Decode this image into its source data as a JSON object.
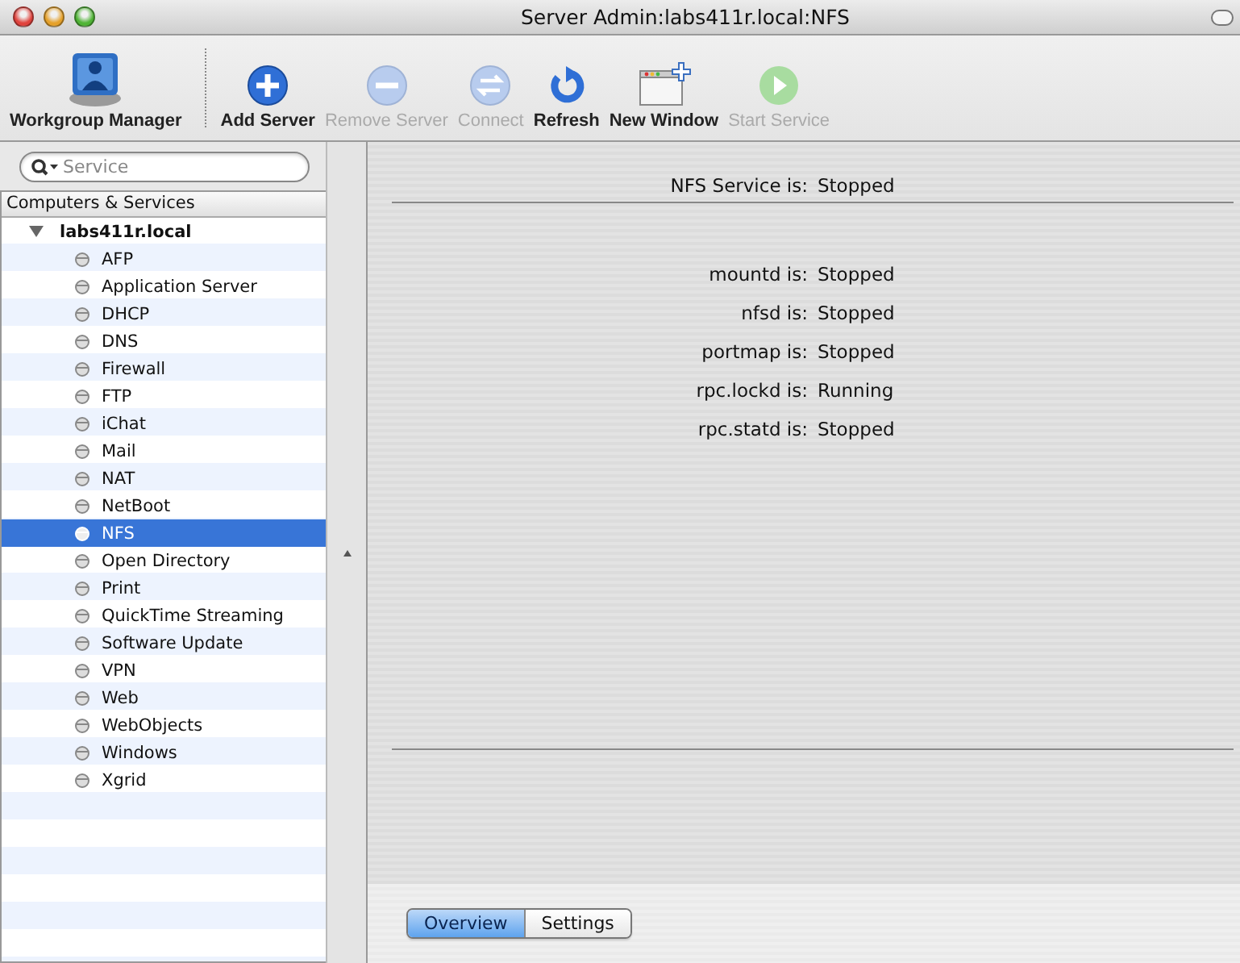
{
  "window": {
    "title": "Server Admin:labs411r.local:NFS"
  },
  "toolbar": [
    {
      "label": "Workgroup Manager",
      "kind": "workgroup",
      "disabled": false
    },
    {
      "label": "Add Server",
      "kind": "add",
      "disabled": false
    },
    {
      "label": "Remove Server",
      "kind": "remove",
      "disabled": true
    },
    {
      "label": "Connect",
      "kind": "connect",
      "disabled": true
    },
    {
      "label": "Refresh",
      "kind": "refresh",
      "disabled": false
    },
    {
      "label": "New Window",
      "kind": "new-window",
      "disabled": false
    },
    {
      "label": "Start Service",
      "kind": "start",
      "disabled": true
    }
  ],
  "search": {
    "placeholder": "Service"
  },
  "sidebar": {
    "header": "Computers & Services",
    "tree": [
      {
        "label": "labs411r.local",
        "expanded": true,
        "children": [
          {
            "label": "AFP",
            "selected": false
          },
          {
            "label": "Application Server",
            "selected": false
          },
          {
            "label": "DHCP",
            "selected": false
          },
          {
            "label": "DNS",
            "selected": false
          },
          {
            "label": "Firewall",
            "selected": false
          },
          {
            "label": "FTP",
            "selected": false
          },
          {
            "label": "iChat",
            "selected": false
          },
          {
            "label": "Mail",
            "selected": false
          },
          {
            "label": "NAT",
            "selected": false
          },
          {
            "label": "NetBoot",
            "selected": false
          },
          {
            "label": "NFS",
            "selected": true
          },
          {
            "label": "Open Directory",
            "selected": false
          },
          {
            "label": "Print",
            "selected": false
          },
          {
            "label": "QuickTime Streaming",
            "selected": false
          },
          {
            "label": "Software Update",
            "selected": false
          },
          {
            "label": "VPN",
            "selected": false
          },
          {
            "label": "Web",
            "selected": false
          },
          {
            "label": "WebObjects",
            "selected": false
          },
          {
            "label": "Windows",
            "selected": false
          },
          {
            "label": "Xgrid",
            "selected": false
          }
        ]
      }
    ]
  },
  "status": {
    "service": {
      "label": "NFS Service is:",
      "value": "Stopped"
    },
    "processes": [
      {
        "label": "mountd is:",
        "value": "Stopped"
      },
      {
        "label": "nfsd is:",
        "value": "Stopped"
      },
      {
        "label": "portmap is:",
        "value": "Stopped"
      },
      {
        "label": "rpc.lockd is:",
        "value": "Running"
      },
      {
        "label": "rpc.statd is:",
        "value": "Stopped"
      }
    ]
  },
  "tabs": [
    {
      "label": "Overview",
      "selected": true
    },
    {
      "label": "Settings",
      "selected": false
    }
  ]
}
